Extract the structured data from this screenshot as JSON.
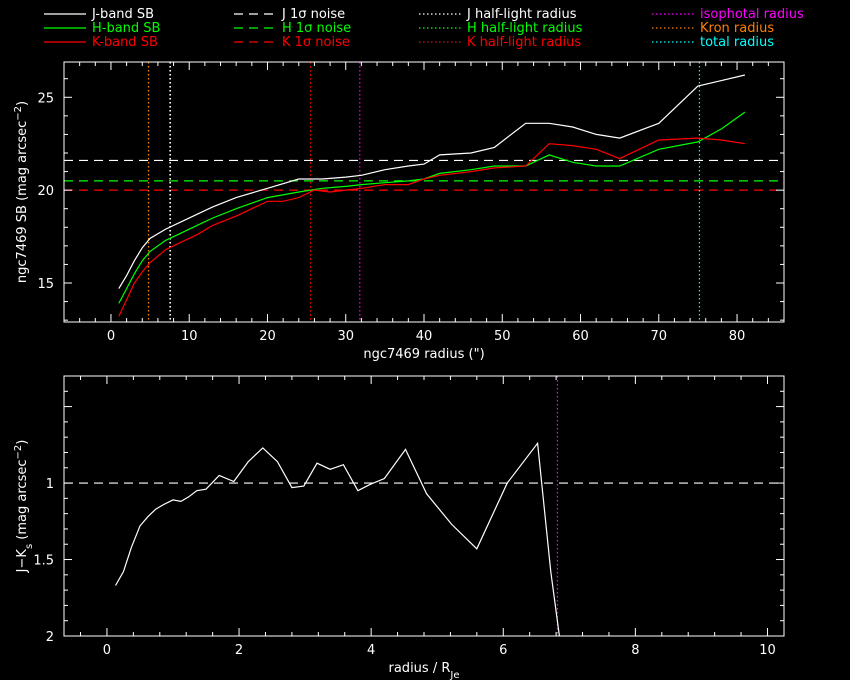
{
  "chart_data": [
    {
      "type": "line",
      "xlabel": "ngc7469 radius (\")",
      "ylabel": "ngc7469 SB (mag arcsec",
      "ylabel_sup": "−2",
      "ylabel_tail": ")",
      "xlim": [
        -6,
        86
      ],
      "ylim": [
        26.9,
        12.9
      ],
      "y_inverted": true,
      "xticks": [
        0,
        10,
        20,
        30,
        40,
        50,
        60,
        70,
        80
      ],
      "yticks": [
        15,
        20,
        25
      ],
      "grid": false,
      "legend": {
        "placement": "top, above plot, three columns"
      },
      "legend_entries": [
        {
          "label": "J-band SB",
          "color": "#ffffff",
          "style": "solid"
        },
        {
          "label": "H-band SB",
          "color": "#00ff00",
          "style": "solid"
        },
        {
          "label": "K-band SB",
          "color": "#ff0000",
          "style": "solid"
        },
        {
          "label": "J 1σ noise",
          "color": "#ffffff",
          "style": "dashed"
        },
        {
          "label": "H 1σ noise",
          "color": "#00ff00",
          "style": "dashed"
        },
        {
          "label": "K 1σ noise",
          "color": "#ff0000",
          "style": "dashed"
        },
        {
          "label": "J half-light radius",
          "color": "#ffffff",
          "style": "dotted"
        },
        {
          "label": "H half-light radius",
          "color": "#00ff00",
          "style": "dotted"
        },
        {
          "label": "K half-light radius",
          "color": "#ff0000",
          "style": "dotted"
        },
        {
          "label": "isophotal radius",
          "color": "#ff00ff",
          "style": "dotted"
        },
        {
          "label": "Kron radius",
          "color": "#ff7f00",
          "style": "dotted"
        },
        {
          "label": "total radius",
          "color": "#00ffff",
          "style": "dotted"
        }
      ],
      "series": [
        {
          "name": "J-band SB",
          "color": "#ffffff",
          "x": [
            1,
            2,
            3,
            4,
            5,
            7,
            9,
            11,
            13,
            16,
            20,
            24,
            27,
            30,
            32,
            35,
            38,
            40,
            42,
            46,
            49,
            53,
            56,
            59,
            62,
            65,
            70,
            75,
            78,
            81
          ],
          "y": [
            14.7,
            15.4,
            16.2,
            16.9,
            17.4,
            17.9,
            18.3,
            18.7,
            19.1,
            19.6,
            20.1,
            20.6,
            20.6,
            20.7,
            20.8,
            21.1,
            21.3,
            21.4,
            21.9,
            22.0,
            22.3,
            23.6,
            23.6,
            23.4,
            23.0,
            22.8,
            23.6,
            25.6,
            25.9,
            26.2
          ]
        },
        {
          "name": "H-band SB",
          "color": "#00ff00",
          "x": [
            1,
            2,
            3,
            4,
            5,
            7,
            9,
            11,
            13,
            16,
            20,
            24,
            27,
            30,
            32,
            35,
            38,
            40,
            42,
            46,
            49,
            53,
            56,
            59,
            62,
            65,
            70,
            75,
            78,
            81
          ],
          "y": [
            13.9,
            14.7,
            15.5,
            16.2,
            16.7,
            17.3,
            17.7,
            18.1,
            18.5,
            19.0,
            19.6,
            19.9,
            20.1,
            20.2,
            20.3,
            20.4,
            20.5,
            20.6,
            20.9,
            21.1,
            21.3,
            21.3,
            21.9,
            21.5,
            21.3,
            21.3,
            22.2,
            22.6,
            23.3,
            24.2
          ]
        },
        {
          "name": "K-band SB",
          "color": "#ff0000",
          "x": [
            1,
            2,
            3,
            4,
            5,
            7,
            9,
            11,
            13,
            16,
            20,
            22,
            24,
            26,
            28,
            30,
            32,
            35,
            38,
            40,
            42,
            46,
            49,
            53,
            56,
            59,
            62,
            65,
            70,
            75,
            78,
            81
          ],
          "y": [
            13.2,
            14.1,
            15.0,
            15.6,
            16.1,
            16.8,
            17.2,
            17.6,
            18.1,
            18.6,
            19.4,
            19.4,
            19.6,
            20.0,
            19.9,
            20.0,
            20.1,
            20.3,
            20.3,
            20.6,
            20.8,
            21.0,
            21.2,
            21.3,
            22.5,
            22.4,
            22.2,
            21.7,
            22.7,
            22.8,
            22.7,
            22.5
          ]
        }
      ],
      "hlines": [
        {
          "name": "J 1σ noise",
          "y": 21.6,
          "color": "#ffffff",
          "style": "dashed"
        },
        {
          "name": "H 1σ noise",
          "y": 20.5,
          "color": "#00ff00",
          "style": "dashed"
        },
        {
          "name": "K 1σ noise",
          "y": 20.0,
          "color": "#ff0000",
          "style": "dashed"
        }
      ],
      "vlines": [
        {
          "name": "K half-light radius",
          "x": 4.8,
          "color": "#ff0000",
          "style": "dotted"
        },
        {
          "name": "Kron radius",
          "x": 4.8,
          "color": "#ff7f00",
          "style": "dotted"
        },
        {
          "name": "H half-light radius",
          "x": 7.5,
          "color": "#00ff00",
          "style": "dotted"
        },
        {
          "name": "J half-light radius",
          "x": 7.6,
          "color": "#ffffff",
          "style": "dotted"
        },
        {
          "name": "K half-light radius (outer)",
          "x": 25.5,
          "color": "#ff0000",
          "style": "dotted"
        },
        {
          "name": "isophotal radius",
          "x": 31.8,
          "color": "#ff00ff",
          "style": "dotted"
        },
        {
          "name": "total radius",
          "x": 75.2,
          "color": "#00ffff",
          "style": "dotted"
        }
      ]
    },
    {
      "type": "line",
      "xlabel": "radius / R",
      "xlabel_sub": "Je",
      "ylabel": "J−K",
      "ylabel_sub": "s",
      "ylabel_tail": " (mag arcsec",
      "ylabel_sup": "−2",
      "ylabel_end": ")",
      "xlim": [
        -0.65,
        10.25
      ],
      "ylim": [
        0.3,
        2.0
      ],
      "xticks": [
        0,
        2,
        4,
        6,
        8,
        10
      ],
      "yticks": [
        1,
        1.5,
        2
      ],
      "ytick_labels": [
        "1",
        "1.5",
        "2"
      ],
      "grid": false,
      "series": [
        {
          "name": "J−Ks",
          "color": "#ffffff",
          "x": [
            0.13,
            0.25,
            0.37,
            0.5,
            0.62,
            0.74,
            0.86,
            1.0,
            1.12,
            1.24,
            1.36,
            1.5,
            1.7,
            1.92,
            2.14,
            2.36,
            2.58,
            2.8,
            2.98,
            3.18,
            3.38,
            3.58,
            3.8,
            3.98,
            4.2,
            4.52,
            4.84,
            5.22,
            5.6,
            6.06,
            6.52,
            6.72,
            6.85
          ],
          "y": [
            1.67,
            1.58,
            1.42,
            1.28,
            1.22,
            1.17,
            1.14,
            1.11,
            1.12,
            1.09,
            1.05,
            1.04,
            0.95,
            0.99,
            0.86,
            0.77,
            0.86,
            1.03,
            1.02,
            0.87,
            0.91,
            0.88,
            1.05,
            1.01,
            0.97,
            0.78,
            1.07,
            1.27,
            1.43,
            1.0,
            0.74,
            1.58,
            2.0
          ]
        }
      ],
      "hlines": [
        {
          "name": "reference",
          "y": 1.0,
          "color": "#ffffff",
          "style": "dashed"
        }
      ],
      "vlines": [
        {
          "name": "isophotal radius",
          "x": 6.82,
          "color": "#ff00ff",
          "style": "dotted"
        }
      ]
    }
  ]
}
